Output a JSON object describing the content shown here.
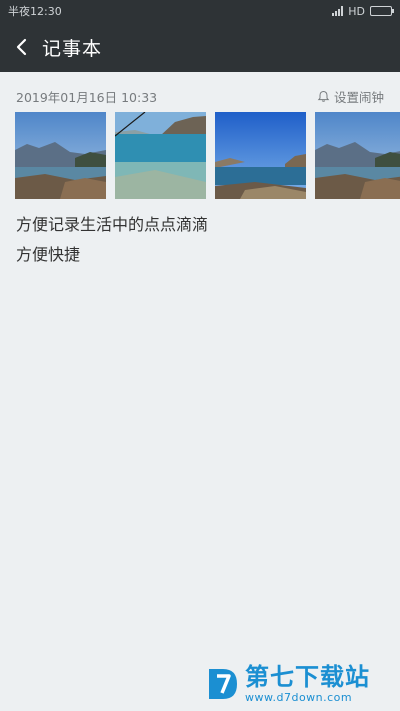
{
  "status_bar": {
    "time": "半夜12:30",
    "network": "HD",
    "battery_level": 0.85
  },
  "header": {
    "title": "记事本"
  },
  "note": {
    "date": "2019年01月16日 10:33",
    "alarm_label": "设置闹钟",
    "photos": [
      {
        "name": "lake-mountain-photo"
      },
      {
        "name": "lakeshore-water-photo"
      },
      {
        "name": "lake-blue-sky-photo"
      },
      {
        "name": "lake-mountain-photo-2"
      }
    ],
    "lines": [
      "方便记录生活中的点点滴滴",
      "方便快捷"
    ]
  },
  "watermark": {
    "brand": "第七下载站",
    "url": "www.d7down.com"
  },
  "colors": {
    "appbar": "#2e3336",
    "background": "#edf0f2",
    "watermark": "#1b8fd2"
  }
}
